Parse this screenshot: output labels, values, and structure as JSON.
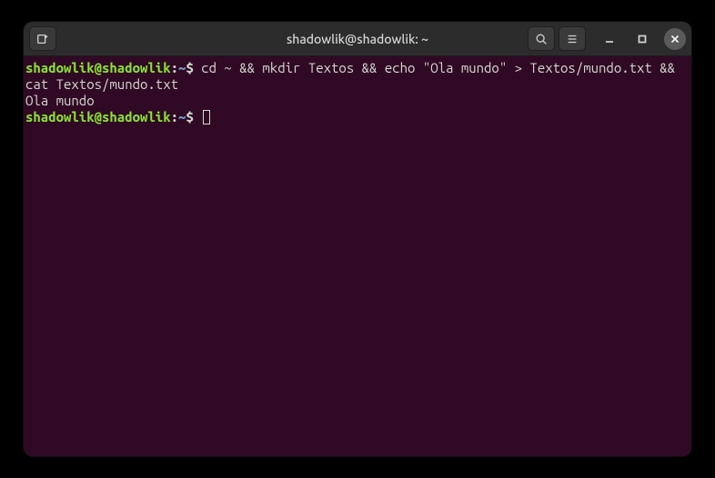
{
  "window": {
    "title": "shadowlik@shadowlik: ~"
  },
  "titlebar": {
    "icons": {
      "newtab": "new-tab-icon",
      "search": "search-icon",
      "menu": "hamburger-menu-icon",
      "minimize": "minimize-icon",
      "maximize": "maximize-icon",
      "close": "close-icon"
    }
  },
  "terminal": {
    "prompts": [
      {
        "user_host": "shadowlik@shadowlik",
        "colon": ":",
        "path": "~",
        "dollar": "$",
        "command": " cd ~ && mkdir Textos && echo \"Ola mundo\" > Textos/mundo.txt && cat Textos/mundo.txt"
      },
      {
        "user_host": "shadowlik@shadowlik",
        "colon": ":",
        "path": "~",
        "dollar": "$",
        "command": " "
      }
    ],
    "output_lines": [
      "Ola mundo"
    ]
  },
  "colors": {
    "bg": "#300a24",
    "titlebar": "#2c2c2c",
    "text": "#d3d7cf",
    "prompt_user": "#8ae234",
    "prompt_path": "#729fcf"
  }
}
